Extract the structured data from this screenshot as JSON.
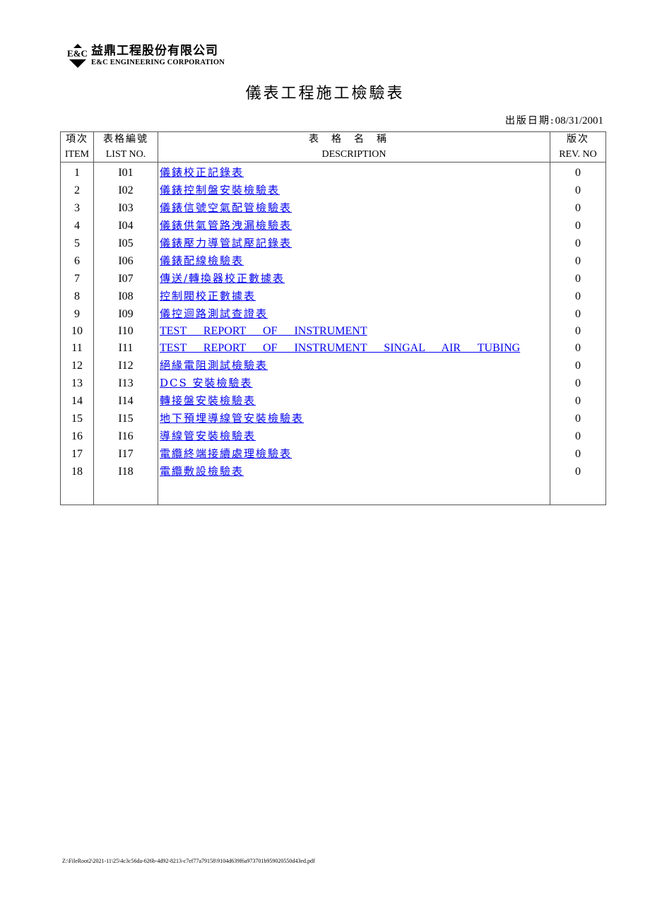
{
  "header": {
    "logo_mark": "E&C",
    "company_cn": "益鼎工程股份有限公司",
    "company_en": "E&C ENGINEERING CORPORATION"
  },
  "title": "儀表工程施工檢驗表",
  "publish": {
    "label": "出版日期:",
    "date": "08/31/2001"
  },
  "table": {
    "headers": [
      {
        "cn": "項次",
        "en": "ITEM"
      },
      {
        "cn": "表格編號",
        "en": "LIST NO."
      },
      {
        "cn": "表格名稱",
        "en": "DESCRIPTION"
      },
      {
        "cn": "版次",
        "en": "REV. NO"
      }
    ],
    "rows": [
      {
        "item": "1",
        "code": "I01",
        "desc": "儀錶校正記錄表",
        "rev": "0"
      },
      {
        "item": "2",
        "code": "I02",
        "desc": "儀錶控制盤安裝檢驗表",
        "rev": "0"
      },
      {
        "item": "3",
        "code": "I03",
        "desc": "儀錶信號空氣配管檢驗表",
        "rev": "0"
      },
      {
        "item": "4",
        "code": "I04",
        "desc": "儀錶供氣管路洩漏檢驗表",
        "rev": "0"
      },
      {
        "item": "5",
        "code": "I05",
        "desc": "儀錶壓力導管試壓記錄表",
        "rev": "0"
      },
      {
        "item": "6",
        "code": "I06",
        "desc": "儀錶配線檢驗表",
        "rev": "0"
      },
      {
        "item": "7",
        "code": "I07",
        "desc": "傳送/轉換器校正數據表",
        "rev": "0"
      },
      {
        "item": "8",
        "code": "I08",
        "desc": "控制閥校正數據表",
        "rev": "0"
      },
      {
        "item": "9",
        "code": "I09",
        "desc": "儀控迴路測試查證表",
        "rev": "0"
      },
      {
        "item": "10",
        "code": "I10",
        "desc": "TEST REPORT OF INSTRUMENT",
        "rev": "0"
      },
      {
        "item": "11",
        "code": "I11",
        "desc": "TEST REPORT OF INSTRUMENT SINGAL AIR TUBING",
        "rev": "0"
      },
      {
        "item": "12",
        "code": "I12",
        "desc": "絕緣電阻測試檢驗表",
        "rev": "0"
      },
      {
        "item": "13",
        "code": "I13",
        "desc": "DCS 安裝檢驗表",
        "rev": "0"
      },
      {
        "item": "14",
        "code": "I14",
        "desc": "轉接盤安裝檢驗表",
        "rev": "0"
      },
      {
        "item": "15",
        "code": "I15",
        "desc": "地下預埋導線管安裝檢驗表",
        "rev": "0"
      },
      {
        "item": "16",
        "code": "I16",
        "desc": "導線管安裝檢驗表",
        "rev": "0"
      },
      {
        "item": "17",
        "code": "I17",
        "desc": "電纜終端接續處理檢驗表",
        "rev": "0"
      },
      {
        "item": "18",
        "code": "I18",
        "desc": "電纜敷設檢驗表",
        "rev": "0"
      }
    ]
  },
  "footer": {
    "path": "Z:\\FileRoot2\\2021-11\\25\\4c3c56da-626b-4d92-8213-c7ef77a79158\\9104d639f6a973701b959020550d43ed.pdf"
  },
  "colors": {
    "link": "#0000ee",
    "border": "#555555"
  }
}
